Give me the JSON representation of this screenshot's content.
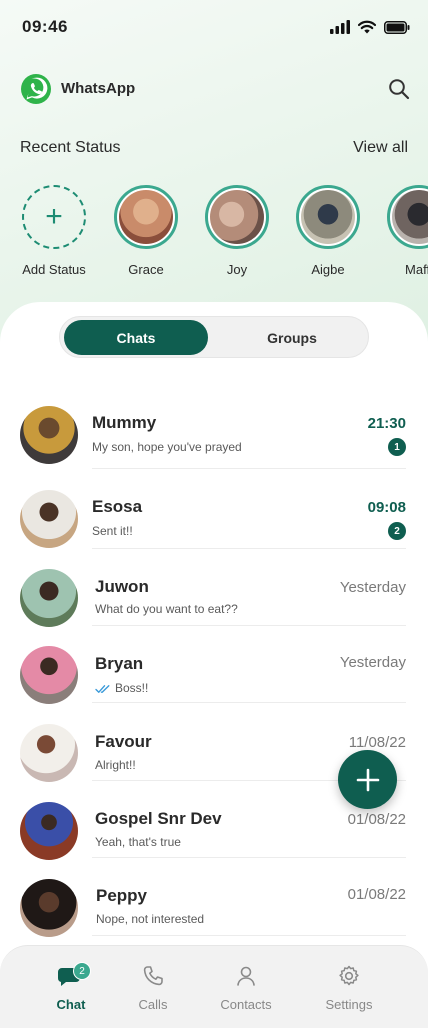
{
  "status_bar": {
    "time": "09:46"
  },
  "header": {
    "app_name": "WhatsApp"
  },
  "recent": {
    "title": "Recent Status",
    "view_all": "View all",
    "add_label": "Add Status",
    "items": [
      {
        "name": "Grace",
        "color": "#c98b6a"
      },
      {
        "name": "Joy",
        "color": "#b48c79"
      },
      {
        "name": "Aigbe",
        "color": "#8d8a7c"
      },
      {
        "name": "Maffi",
        "color": "#6f6460"
      }
    ]
  },
  "tabs": {
    "chats": "Chats",
    "groups": "Groups"
  },
  "chats": [
    {
      "name": "Mummy",
      "preview": "My son, hope you've prayed",
      "time": "21:30",
      "unread": "1",
      "color": "#8a6a3f"
    },
    {
      "name": "Esosa",
      "preview": "Sent it!!",
      "time": "09:08",
      "unread": "2",
      "color": "#a9b3b5"
    },
    {
      "name": "Juwon",
      "preview": "What do you want to eat??",
      "time": "Yesterday",
      "color": "#6e8c7b"
    },
    {
      "name": "Bryan",
      "preview": "Boss!!",
      "time": "Yesterday",
      "color": "#e48aa6"
    },
    {
      "name": "Favour",
      "preview": "Alright!!",
      "time": "11/08/22",
      "color": "#c9b8b3"
    },
    {
      "name": "Gospel Snr Dev",
      "preview": "Yeah, that's true",
      "time": "01/08/22",
      "color": "#3a4fa8"
    },
    {
      "name": "Peppy",
      "preview": "Nope, not interested",
      "time": "01/08/22",
      "color": "#3b2b25"
    }
  ],
  "nav": {
    "chat": "Chat",
    "chat_badge": "2",
    "calls": "Calls",
    "contacts": "Contacts",
    "settings": "Settings"
  },
  "colors": {
    "primary": "#0f5e50",
    "accent": "#3ba88f"
  }
}
